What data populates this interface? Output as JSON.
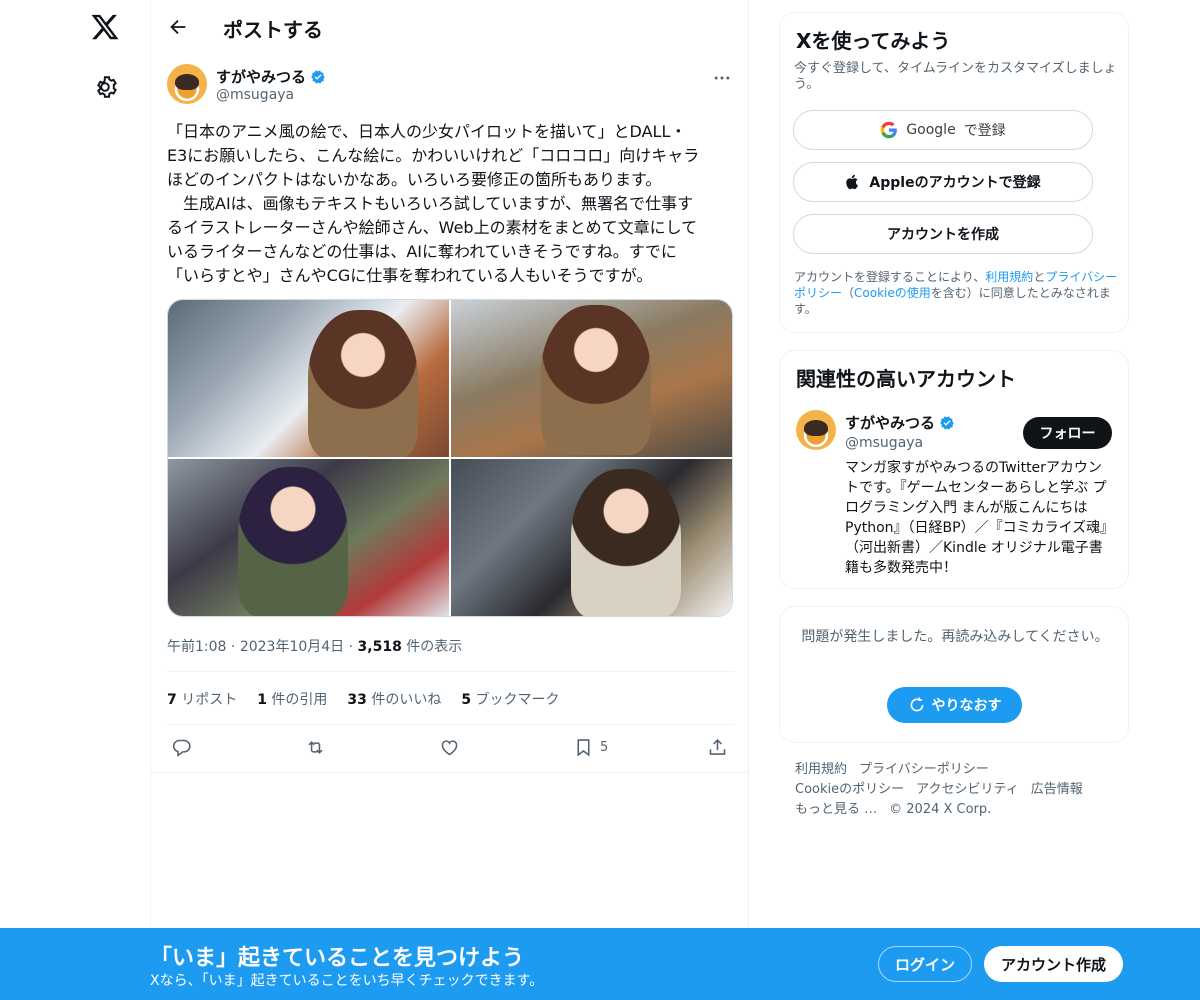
{
  "header": {
    "title": "ポストする"
  },
  "tweet": {
    "author_name": "すがやみつる",
    "author_handle": "@msugaya",
    "text": "「日本のアニメ風の絵で、日本人の少女パイロットを描いて」とDALL・\nE3にお願いしたら、こんな絵に。かわいいけれど「コロコロ」向けキャラ\nほどのインパクトはないかなあ。いろいろ要修正の箇所もあります。\n　生成AIは、画像もテキストもいろいろ試していますが、無署名で仕事す\nるイラストレーターさんや絵師さん、Web上の素材をまとめて文章にして\nいるライターさんなどの仕事は、AIに奪われていきそうですね。すでに\n「いらすとや」さんやCGに仕事を奪われている人もいそうですが。",
    "time": "午前1:08",
    "date": "2023年10月4日",
    "views_count": "3,518",
    "views_label": "件の表示",
    "reposts_count": "7",
    "reposts_label": "リポスト",
    "quotes_count": "1",
    "quotes_label": "件の引用",
    "likes_count": "33",
    "likes_label": "件のいいね",
    "bookmarks_count": "5",
    "bookmarks_label": "ブックマーク",
    "bookmark_action_count": "5"
  },
  "signup_card": {
    "title": "Xを使ってみよう",
    "subtitle": "今すぐ登録して、タイムラインをカスタマイズしましょう。",
    "google_brand": "Google",
    "google_label": "で登録",
    "apple_label": "Appleのアカウントで登録",
    "create_label": "アカウントを作成",
    "terms_prefix": "アカウントを登録することにより、",
    "terms_link": "利用規約",
    "terms_and": "と",
    "privacy_link": "プライバシーポリシー",
    "terms_paren_open": "（",
    "cookie_link": "Cookieの使用",
    "terms_suffix": "を含む）に同意したとみなされます。"
  },
  "related": {
    "title": "関連性の高いアカウント",
    "name": "すがやみつる",
    "handle": "@msugaya",
    "follow_label": "フォロー",
    "bio": "マンガ家すがやみつるのTwitterアカウントです。『ゲームセンターあらしと学ぶ プログラミング入門 まんが版こんにちはPython』（日経BP）／『コミカライズ魂』（河出新書）／Kindle オリジナル電子書籍も多数発売中！"
  },
  "error_card": {
    "message": "問題が発生しました。再読み込みしてください。",
    "retry_label": "やりなおす"
  },
  "footer": {
    "terms": "利用規約",
    "privacy": "プライバシーポリシー",
    "cookie": "Cookieのポリシー",
    "accessibility": "アクセシビリティ",
    "ads": "広告情報",
    "more": "もっと見る …",
    "copyright": "© 2024 X Corp."
  },
  "banner": {
    "title": "「いま」起きていることを見つけよう",
    "subtitle": "Xなら、「いま」起きていることをいち早くチェックできます。",
    "login_label": "ログイン",
    "signup_label": "アカウント作成"
  },
  "colors": {
    "accent": "#1d9bf0",
    "text": "#0f1419",
    "muted": "#536471"
  }
}
